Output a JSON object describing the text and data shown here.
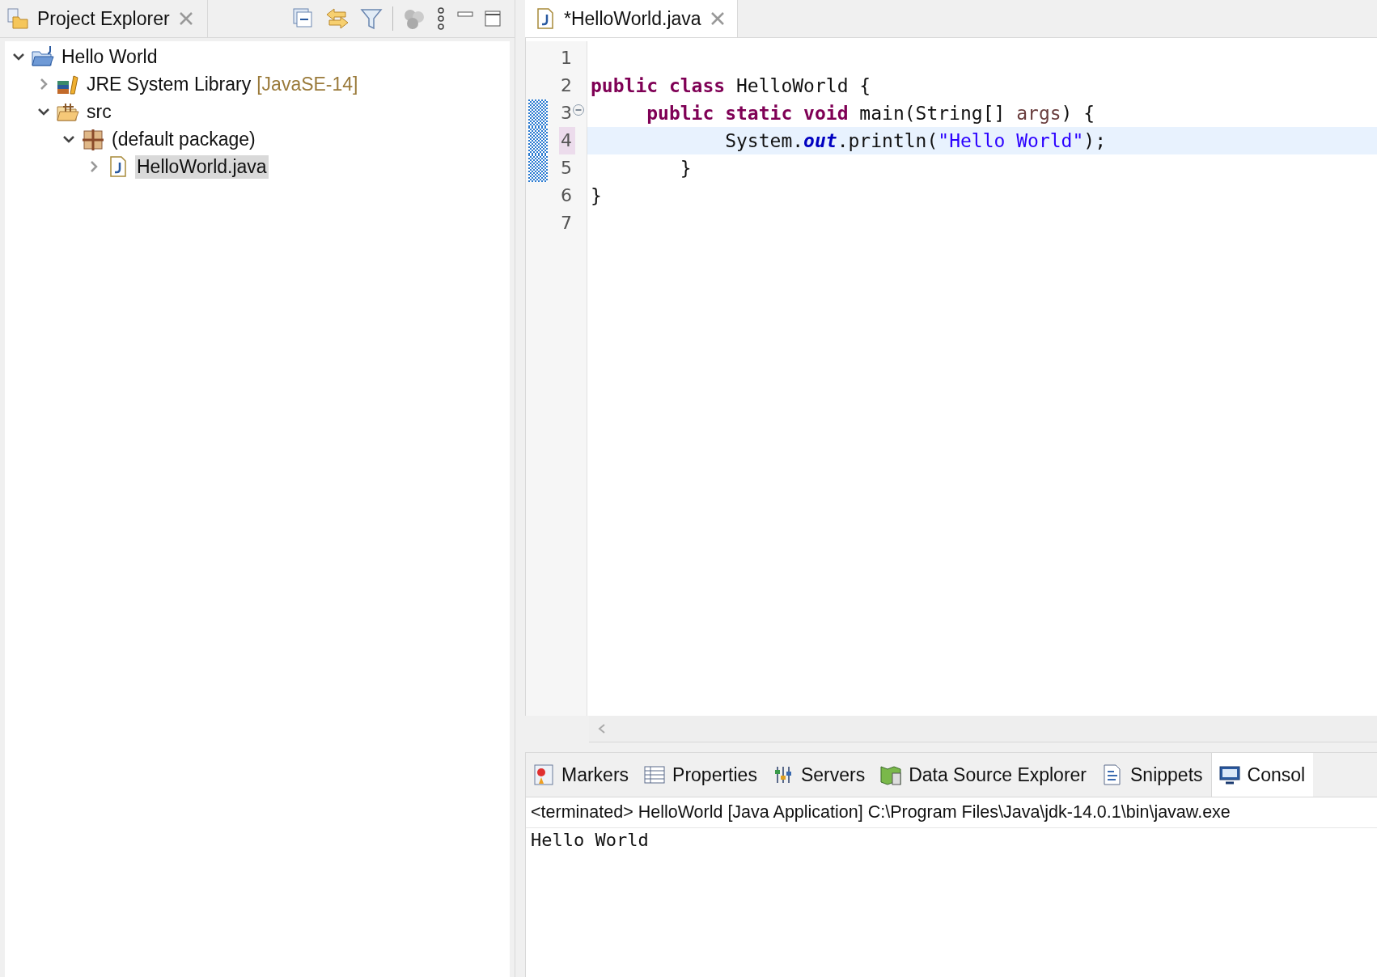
{
  "project_explorer": {
    "title": "Project Explorer",
    "tree": [
      {
        "label": "Hello World",
        "expanded": true,
        "selected": false,
        "children": [
          {
            "label": "JRE System Library",
            "decoration": "[JavaSE-14]",
            "expanded": false,
            "selected": false
          },
          {
            "label": "src",
            "expanded": true,
            "selected": false,
            "children": [
              {
                "label": "(default package)",
                "expanded": true,
                "selected": false,
                "children": [
                  {
                    "label": "HelloWorld.java",
                    "expanded": false,
                    "selected": true
                  }
                ]
              }
            ]
          }
        ]
      }
    ]
  },
  "editor": {
    "tab_title": "*HelloWorld.java",
    "lines": [
      {
        "number": "1",
        "changed": false,
        "current": false,
        "fold": false
      },
      {
        "number": "2",
        "changed": false,
        "current": false,
        "fold": false,
        "tokens": [
          {
            "kind": "keyword",
            "text": "public class"
          },
          {
            "kind": "plain",
            "text": " HelloWorld {"
          }
        ]
      },
      {
        "number": "3",
        "changed": true,
        "current": false,
        "fold": true,
        "tokens": [
          {
            "kind": "keyword",
            "text": "     public static void"
          },
          {
            "kind": "plain",
            "text": " main(String[] "
          },
          {
            "kind": "param",
            "text": "args"
          },
          {
            "kind": "plain",
            "text": ") {"
          }
        ]
      },
      {
        "number": "4",
        "changed": true,
        "current": true,
        "fold": false,
        "tokens": [
          {
            "kind": "plain",
            "text": "            System."
          },
          {
            "kind": "field",
            "text": "out"
          },
          {
            "kind": "plain",
            "text": ".println("
          },
          {
            "kind": "string",
            "text": "\"Hello World\""
          },
          {
            "kind": "plain",
            "text": ");"
          }
        ]
      },
      {
        "number": "5",
        "changed": true,
        "current": false,
        "fold": false,
        "tokens": [
          {
            "kind": "plain",
            "text": "        }"
          }
        ]
      },
      {
        "number": "6",
        "changed": false,
        "current": false,
        "fold": false,
        "tokens": [
          {
            "kind": "plain",
            "text": "}"
          }
        ]
      },
      {
        "number": "7",
        "changed": false,
        "current": false,
        "fold": false
      }
    ]
  },
  "bottom_panel": {
    "tabs": [
      {
        "label": "Markers",
        "selected": false
      },
      {
        "label": "Properties",
        "selected": false
      },
      {
        "label": "Servers",
        "selected": false
      },
      {
        "label": "Data Source Explorer",
        "selected": false
      },
      {
        "label": "Snippets",
        "selected": false
      },
      {
        "label": "Consol",
        "selected": true
      }
    ],
    "console_header": "<terminated> HelloWorld [Java Application] C:\\Program Files\\Java\\jdk-14.0.1\\bin\\javaw.exe",
    "output": "Hello World"
  }
}
